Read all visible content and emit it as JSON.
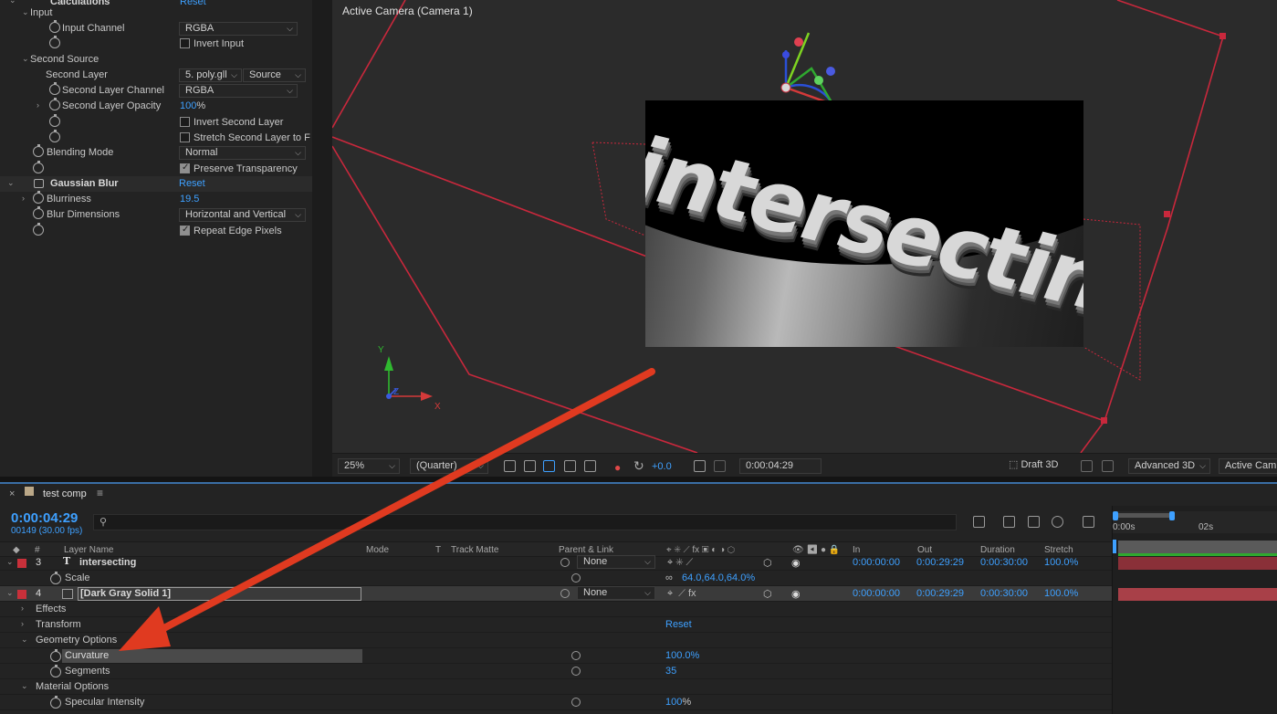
{
  "effects": {
    "top_partial": {
      "name": "Calculations",
      "reset": "Reset"
    },
    "input_group": "Input",
    "input_channel": {
      "label": "Input Channel",
      "value": "RGBA"
    },
    "invert_input": "Invert Input",
    "second_source_group": "Second Source",
    "second_layer": {
      "label": "Second Layer",
      "value": "5. poly.gll",
      "source": "Source"
    },
    "second_layer_channel": {
      "label": "Second Layer Channel",
      "value": "RGBA"
    },
    "second_layer_opacity": {
      "label": "Second Layer Opacity",
      "value": "100",
      "unit": "%"
    },
    "invert_second_layer": "Invert Second Layer",
    "stretch_second_layer": "Stretch Second Layer to F",
    "blending_mode": {
      "label": "Blending Mode",
      "value": "Normal"
    },
    "preserve_transparency": "Preserve Transparency",
    "gaussian_blur": {
      "name": "Gaussian Blur",
      "reset": "Reset"
    },
    "blurriness": {
      "label": "Blurriness",
      "value": "19.5"
    },
    "blur_dimensions": {
      "label": "Blur Dimensions",
      "value": "Horizontal and Vertical"
    },
    "repeat_edge_pixels": "Repeat Edge Pixels"
  },
  "viewer": {
    "title": "Active Camera (Camera 1)",
    "render_text": "intersecting",
    "axis": {
      "y": "Y",
      "z": "Z",
      "x": "X"
    },
    "bottom_bar": {
      "zoom": "25%",
      "resolution": "(Quarter)",
      "exposure": "+0.0",
      "timecode": "0:00:04:29",
      "renderer": "Draft 3D",
      "mode": "Advanced 3D",
      "view": "Active Cam"
    }
  },
  "timeline": {
    "tab": "test comp",
    "current_time": "0:00:04:29",
    "frame_info": "00149 (30.00 fps)",
    "columns": {
      "num": "#",
      "layer_name": "Layer Name",
      "mode": "Mode",
      "t": "T",
      "track_matte": "Track Matte",
      "parent": "Parent & Link",
      "in": "In",
      "out": "Out",
      "duration": "Duration",
      "stretch": "Stretch"
    },
    "layers": [
      {
        "num": "3",
        "name": "intersecting",
        "parent": "None",
        "in": "0:00:00:00",
        "out": "0:00:29:29",
        "duration": "0:00:30:00",
        "stretch": "100.0%"
      },
      {
        "num": "4",
        "name": "[Dark Gray Solid 1]",
        "parent": "None",
        "in": "0:00:00:00",
        "out": "0:00:29:29",
        "duration": "0:00:30:00",
        "stretch": "100.0%"
      }
    ],
    "props": {
      "scale": {
        "label": "Scale",
        "value": "64.0,64.0,64.0%"
      },
      "effects": "Effects",
      "transform": {
        "label": "Transform",
        "reset": "Reset"
      },
      "geometry_options": "Geometry Options",
      "curvature": {
        "label": "Curvature",
        "value": "100.0%"
      },
      "segments": {
        "label": "Segments",
        "value": "35"
      },
      "material_options": "Material Options",
      "specular_intensity": {
        "label": "Specular Intensity",
        "value": "100",
        "unit": "%"
      }
    },
    "ruler": {
      "t0": "0:00s",
      "t1": "02s"
    }
  },
  "colors": {
    "accent_blue": "#3ea0ff",
    "label_red": "#c8303a",
    "annotation_arrow": "#e03a20",
    "bounding_box": "#c8283c"
  }
}
